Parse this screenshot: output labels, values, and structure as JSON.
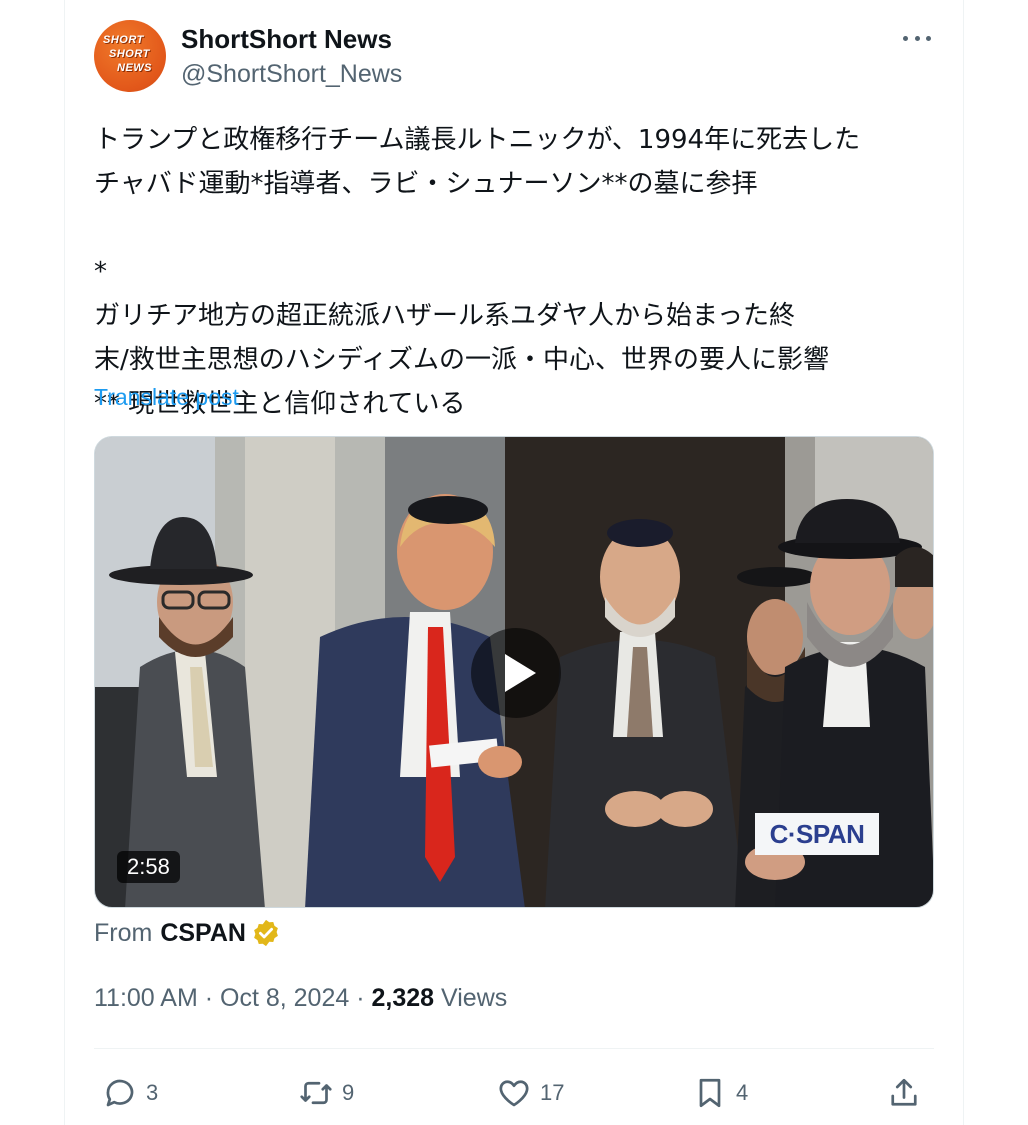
{
  "author": {
    "display_name": "ShortShort News",
    "handle": "@ShortShort_News",
    "avatar_text": [
      "SHORT",
      "SHORT",
      "NEWS"
    ]
  },
  "post": {
    "lines": [
      "トランプと政権移行チーム議長ルトニックが、1994年に死去した",
      "チャバド運動*指導者、ラビ・シュナーソン**の墓に参拝"
    ],
    "footnote_1_prefix": "*",
    "footnote_1_line1": "ガリチア地方の超正統派ハザール系ユダヤ人から始まった終",
    "footnote_1_line2": "末/救世主思想のハシディズムの一派・中心、世界の要人に影響",
    "footnote_2": "** 現世救世主と信仰されている",
    "flag_icon": "ukraine-flag-icon",
    "translate_label": "Translate post"
  },
  "video": {
    "duration": "2:58",
    "watermark": "C·SPAN"
  },
  "source": {
    "from_label": "From",
    "name": "CSPAN",
    "verified_icon": "gold-verified-badge-icon"
  },
  "meta": {
    "time": "11:00 AM",
    "separator": "·",
    "date": "Oct 8, 2024",
    "views_count": "2,328",
    "views_label": "Views"
  },
  "actions": {
    "replies": "3",
    "reposts": "9",
    "likes": "17",
    "bookmarks": "4"
  },
  "colors": {
    "link": "#1d9bf0",
    "secondary_text": "#536471",
    "primary_text": "#0f1419",
    "avatar_orange": "#e2571a",
    "verified_gold": "#e2b719"
  }
}
